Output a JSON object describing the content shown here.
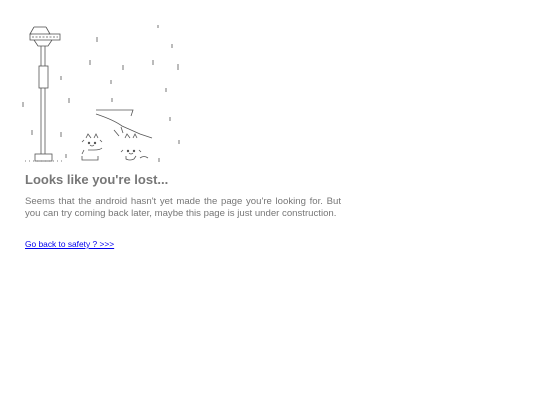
{
  "illustration": {
    "icon": "ascii-art-streetlamp-cats-rain"
  },
  "title": "Looks like you're lost...",
  "message": "Seems that the android hasn't yet made the page you're looking for. But you can try coming back later, maybe this page is just under construction.",
  "back_link": {
    "label": "Go back to safety ? >>>"
  },
  "colors": {
    "text": "#777777",
    "link": "#0000ee",
    "background": "#ffffff",
    "art": "#555555"
  }
}
